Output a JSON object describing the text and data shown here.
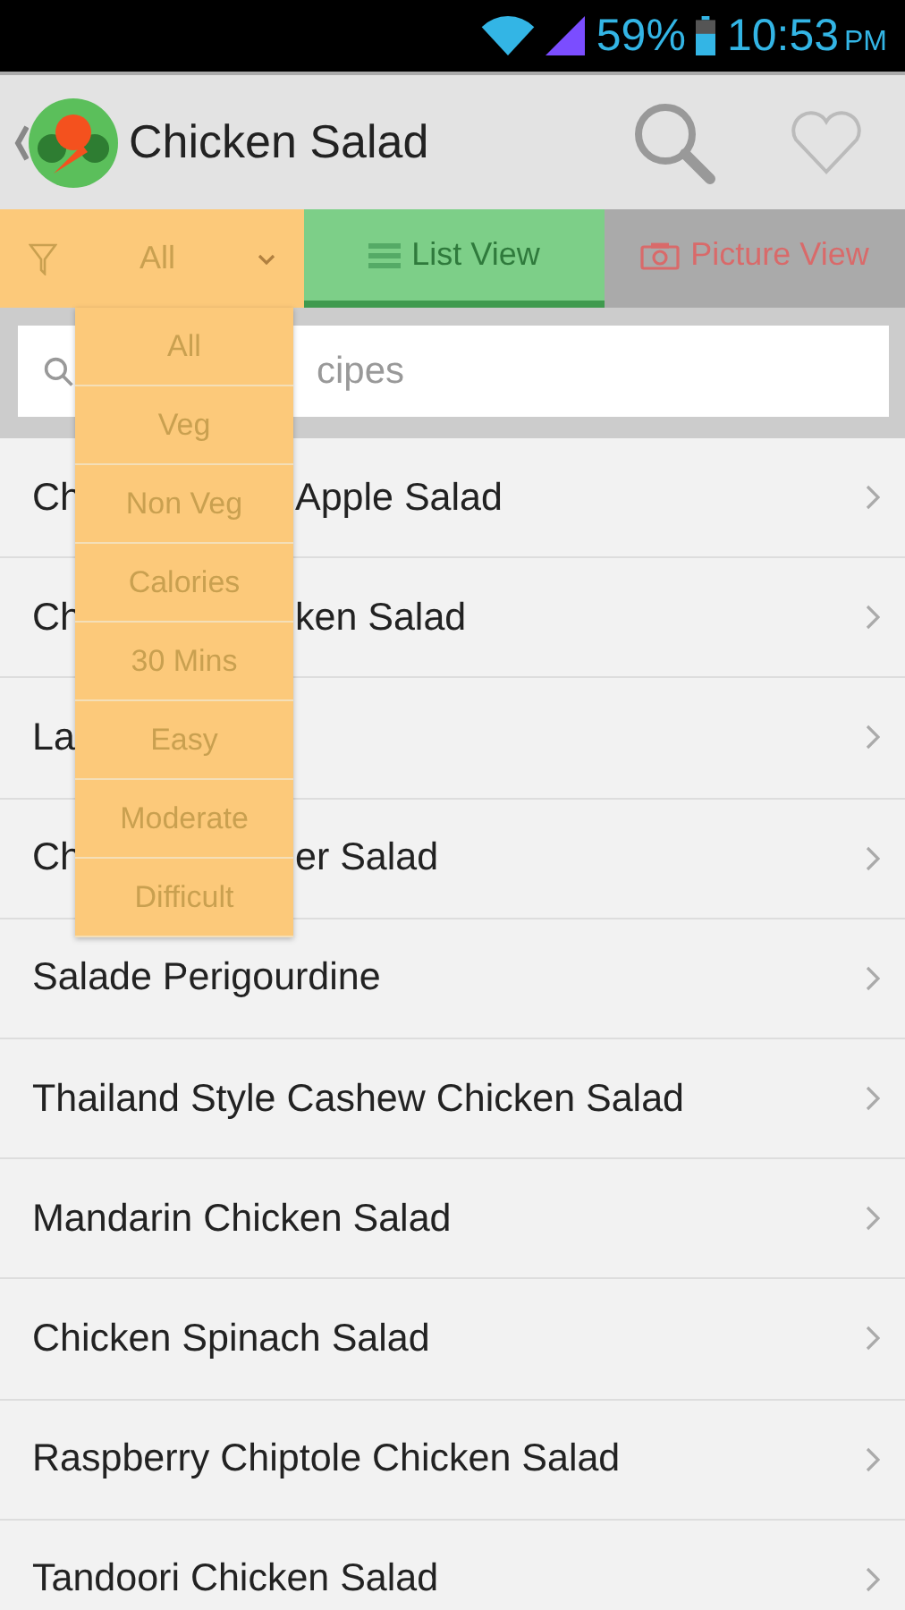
{
  "status_bar": {
    "battery": "59%",
    "time": "10:53",
    "ampm": "PM"
  },
  "app_bar": {
    "title": "Chicken Salad"
  },
  "filter": {
    "label": "All",
    "expanded": true
  },
  "tabs": [
    {
      "label": "List View",
      "selected": true
    },
    {
      "label": "Picture View",
      "selected": false
    }
  ],
  "search": {
    "placeholder_visible": "cipes"
  },
  "filter_menu": [
    "All",
    "Veg",
    "Non Veg",
    "Calories",
    "30 Mins",
    "Easy",
    "Moderate",
    "Difficult"
  ],
  "recipes": [
    {
      "start": "Ch",
      "end": "Apple Salad"
    },
    {
      "start": "Ch",
      "end": "ken Salad"
    },
    {
      "start": "La"
    },
    {
      "start": "Ch",
      "end": "er Salad"
    },
    {
      "start": "Salade Perigourdine"
    },
    {
      "start": "Thailand Style Cashew Chicken Salad"
    },
    {
      "start": "Mandarin Chicken Salad"
    },
    {
      "start": "Chicken Spinach Salad"
    },
    {
      "start": "Raspberry Chiptole Chicken Salad"
    },
    {
      "start": "Tandoori Chicken Salad"
    }
  ]
}
